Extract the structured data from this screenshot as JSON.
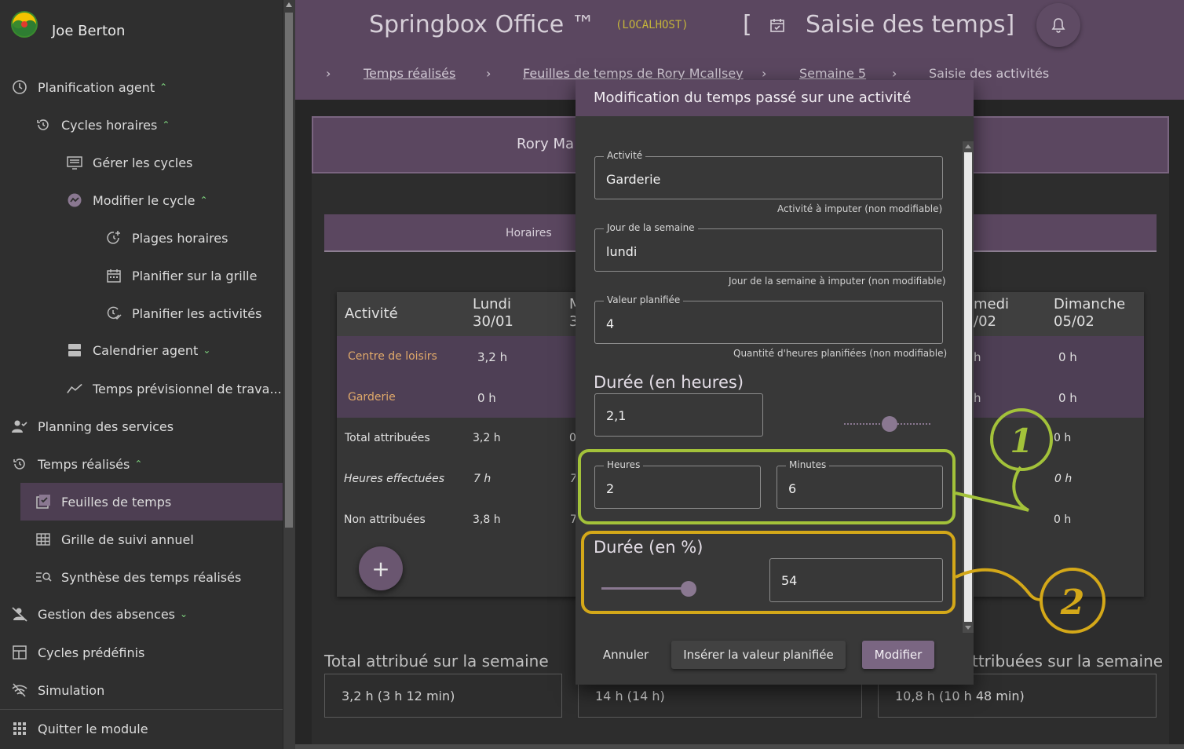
{
  "sidebar": {
    "user_name": "Joe Berton",
    "items": [
      {
        "label": "Planification agent",
        "icon": "clock-icon",
        "expanded": true
      },
      {
        "label": "Cycles horaires",
        "icon": "history-icon",
        "expanded": true
      },
      {
        "label": "Gérer les cycles",
        "icon": "monitor-list-icon"
      },
      {
        "label": "Modifier le cycle",
        "icon": "cycle-edit-icon",
        "expanded": true
      },
      {
        "label": "Plages horaires",
        "icon": "clock-add-icon"
      },
      {
        "label": "Planifier sur la grille",
        "icon": "calendar-grid-icon"
      },
      {
        "label": "Planifier les activités",
        "icon": "clock-check-icon"
      },
      {
        "label": "Calendrier agent",
        "icon": "calendar-block-icon",
        "expanded": false
      },
      {
        "label": "Temps prévisionnel de trava...",
        "icon": "trend-line-icon"
      },
      {
        "label": "Planning des services",
        "icon": "person-check-icon"
      },
      {
        "label": "Temps réalisés",
        "icon": "history-icon",
        "expanded": true
      },
      {
        "label": "Feuilles de temps",
        "icon": "checklist-icon",
        "active": true
      },
      {
        "label": "Grille de suivi annuel",
        "icon": "grid-icon"
      },
      {
        "label": "Synthèse des temps réalisés",
        "icon": "list-search-icon"
      },
      {
        "label": "Gestion des absences",
        "icon": "person-off-icon",
        "expanded": false
      },
      {
        "label": "Cycles prédéfinis",
        "icon": "layout-icon"
      },
      {
        "label": "Simulation",
        "icon": "wifi-off-icon"
      },
      {
        "label": "Quitter le module",
        "icon": "apps-icon"
      }
    ]
  },
  "header": {
    "app_title": "Springbox Office ™",
    "env": "(LOCALHOST)",
    "bracket_open": "[",
    "page_title": "Saisie des temps]",
    "breadcrumbs": [
      "Temps réalisés",
      "Feuilles de temps de Rory Mcallsey",
      "Semaine 5",
      "Saisie des activités"
    ],
    "crumb_sep": "›"
  },
  "main": {
    "person_name": "Rory Ma",
    "tab_label": "Horaires",
    "table": {
      "headers": {
        "activity": "Activité",
        "lundi_day": "Lundi",
        "lundi_date": "30/01",
        "mardi_frag": "M",
        "mardi_frag2": "3",
        "samedi_day": "medi",
        "samedi_date": "/02",
        "dimanche_day": "Dimanche",
        "dimanche_date": "05/02"
      },
      "rows": [
        {
          "label": "Centre de loisirs",
          "lundi": "3,2 h",
          "samedi": "h",
          "dimanche": "0 h"
        },
        {
          "label": "Garderie",
          "lundi": "0 h",
          "samedi": "h",
          "dimanche": "0 h"
        },
        {
          "label": "Total attribuées",
          "lundi": "3,2 h",
          "mardi": "0",
          "dimanche": "0 h"
        },
        {
          "label": "Heures effectuées",
          "lundi": "7 h",
          "mardi": "7",
          "dimanche": "0 h"
        },
        {
          "label": "Non attribuées",
          "lundi": "3,8 h",
          "mardi": "7",
          "dimanche": "0 h"
        }
      ]
    },
    "fab": "+",
    "totals": [
      {
        "title": "Total attribué sur la semaine",
        "value": "3,2 h (3 h 12 min)"
      },
      {
        "title": "",
        "value": "14 h (14 h)"
      },
      {
        "title": "ttribuées sur la semaine",
        "value": "10,8 h (10 h 48 min)"
      }
    ]
  },
  "dialog": {
    "title": "Modification du temps passé sur une activité",
    "activity": {
      "label": "Activité",
      "value": "Garderie",
      "helper": "Activité à imputer (non modifiable)"
    },
    "day": {
      "label": "Jour de la semaine",
      "value": "lundi",
      "helper": "Jour de la semaine à imputer (non modifiable)"
    },
    "planned": {
      "label": "Valeur planifiée",
      "value": "4",
      "helper": "Quantité d'heures planifiées (non modifiable)"
    },
    "hours_section": {
      "title": "Durée (en heures)",
      "value": "2,1",
      "slider_fraction": 0.58
    },
    "hours": {
      "label": "Heures",
      "value": "2"
    },
    "minutes": {
      "label": "Minutes",
      "value": "6"
    },
    "percent_section": {
      "title": "Durée (en %)",
      "value": "54",
      "slider_fraction": 1.0
    },
    "buttons": {
      "cancel": "Annuler",
      "insert": "Insérer la valeur planifiée",
      "modify": "Modifier"
    }
  },
  "annotations": [
    {
      "number": "1",
      "color": "#a3c23a"
    },
    {
      "number": "2",
      "color": "#d4a819"
    }
  ]
}
